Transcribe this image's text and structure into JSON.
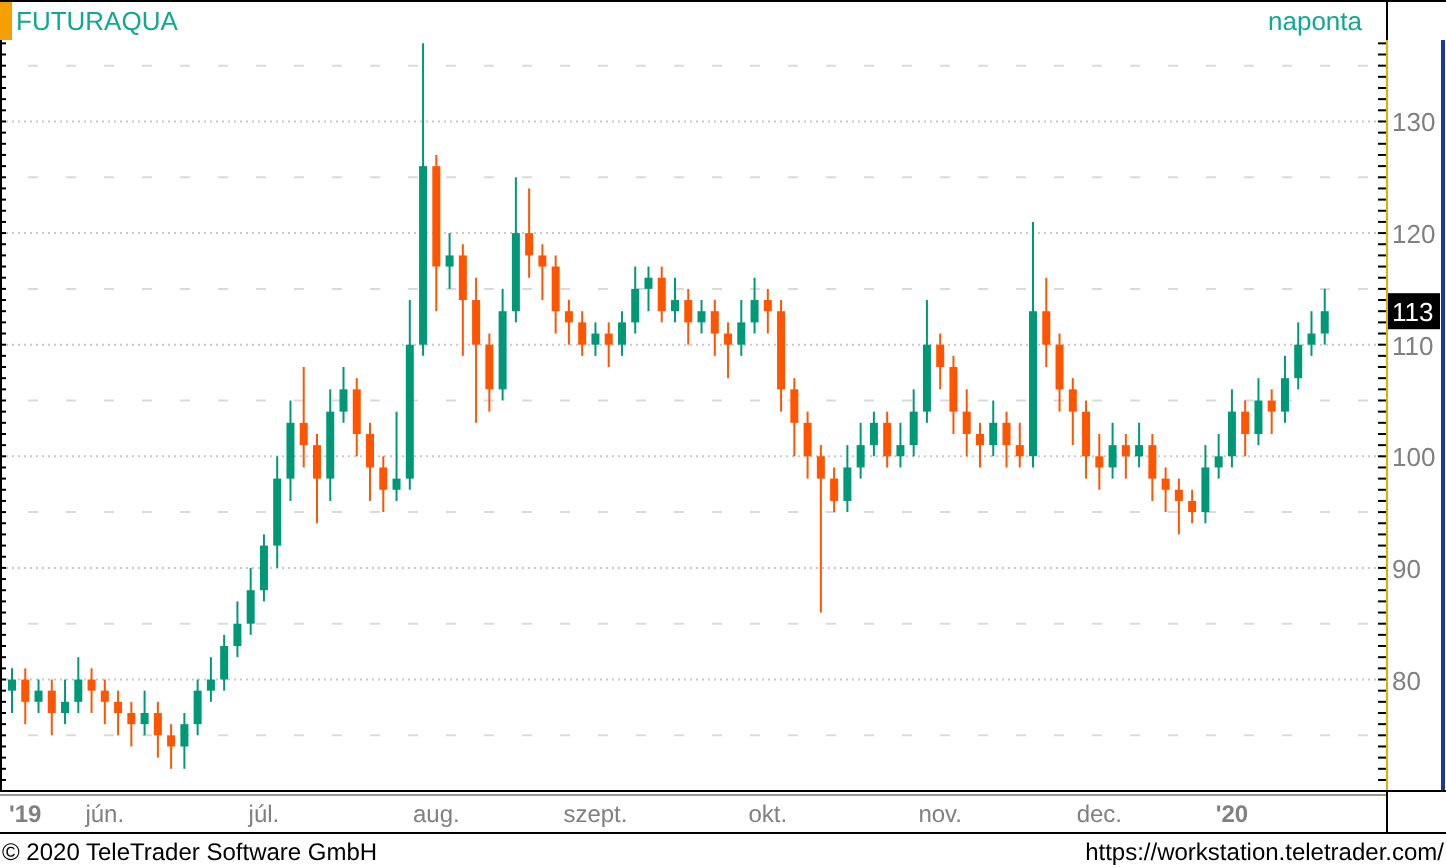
{
  "header": {
    "symbol": "FUTURAQUA",
    "interval": "naponta"
  },
  "chart": {
    "last_price_label": "113",
    "chart_data": {
      "type": "candlestick",
      "grid": true,
      "ylim": [
        70.1,
        137.3
      ],
      "yticks": [
        80,
        90,
        100,
        110,
        120,
        130
      ],
      "categories": [
        null,
        "'19",
        null,
        null,
        null,
        null,
        null,
        "jún.",
        null,
        null,
        null,
        null,
        null,
        null,
        null,
        null,
        null,
        null,
        null,
        "júl.",
        null,
        null,
        null,
        null,
        null,
        null,
        null,
        null,
        null,
        null,
        null,
        null,
        "aug.",
        null,
        null,
        null,
        null,
        null,
        null,
        null,
        null,
        null,
        null,
        null,
        "szept.",
        null,
        null,
        null,
        null,
        null,
        null,
        null,
        null,
        null,
        null,
        null,
        null,
        "okt.",
        null,
        null,
        null,
        null,
        null,
        null,
        null,
        null,
        null,
        null,
        null,
        null,
        "nov.",
        null,
        null,
        null,
        null,
        null,
        null,
        null,
        null,
        null,
        null,
        null,
        "dec.",
        null,
        null,
        null,
        null,
        null,
        null,
        null,
        null,
        null,
        "'20",
        null,
        null,
        null,
        null,
        null,
        null,
        null
      ],
      "ohlc": [
        [
          79,
          81,
          77,
          80
        ],
        [
          80,
          81,
          76,
          78
        ],
        [
          78,
          80,
          77,
          79
        ],
        [
          79,
          80,
          75,
          77
        ],
        [
          77,
          80,
          76,
          78
        ],
        [
          78,
          82,
          77,
          80
        ],
        [
          80,
          81,
          77,
          79
        ],
        [
          79,
          80,
          76,
          78
        ],
        [
          78,
          79,
          75,
          77
        ],
        [
          77,
          78,
          74,
          76
        ],
        [
          76,
          79,
          75,
          77
        ],
        [
          77,
          78,
          73,
          75
        ],
        [
          75,
          76,
          72,
          74
        ],
        [
          74,
          77,
          72,
          76
        ],
        [
          76,
          80,
          75,
          79
        ],
        [
          79,
          82,
          78,
          80
        ],
        [
          80,
          84,
          79,
          83
        ],
        [
          83,
          87,
          82,
          85
        ],
        [
          85,
          90,
          84,
          88
        ],
        [
          88,
          93,
          87,
          92
        ],
        [
          92,
          100,
          90,
          98
        ],
        [
          98,
          105,
          96,
          103
        ],
        [
          103,
          108,
          99,
          101
        ],
        [
          101,
          102,
          94,
          98
        ],
        [
          98,
          106,
          96,
          104
        ],
        [
          104,
          108,
          103,
          106
        ],
        [
          106,
          107,
          100,
          102
        ],
        [
          102,
          103,
          96,
          99
        ],
        [
          99,
          100,
          95,
          97
        ],
        [
          97,
          104,
          96,
          98
        ],
        [
          98,
          114,
          97,
          110
        ],
        [
          110,
          137,
          109,
          126
        ],
        [
          126,
          127,
          113,
          117
        ],
        [
          117,
          120,
          115,
          118
        ],
        [
          118,
          119,
          109,
          114
        ],
        [
          114,
          116,
          103,
          110
        ],
        [
          110,
          111,
          104,
          106
        ],
        [
          106,
          115,
          105,
          113
        ],
        [
          113,
          125,
          112,
          120
        ],
        [
          120,
          124,
          116,
          118
        ],
        [
          118,
          119,
          114,
          117
        ],
        [
          117,
          118,
          111,
          113
        ],
        [
          113,
          114,
          110,
          112
        ],
        [
          112,
          113,
          109,
          110
        ],
        [
          110,
          112,
          109,
          111
        ],
        [
          111,
          112,
          108,
          110
        ],
        [
          110,
          113,
          109,
          112
        ],
        [
          112,
          117,
          111,
          115
        ],
        [
          115,
          117,
          113,
          116
        ],
        [
          116,
          117,
          112,
          113
        ],
        [
          113,
          116,
          112,
          114
        ],
        [
          114,
          115,
          110,
          112
        ],
        [
          112,
          114,
          111,
          113
        ],
        [
          113,
          114,
          109,
          111
        ],
        [
          111,
          112,
          107,
          110
        ],
        [
          110,
          114,
          109,
          112
        ],
        [
          112,
          116,
          111,
          114
        ],
        [
          114,
          115,
          111,
          113
        ],
        [
          113,
          114,
          104,
          106
        ],
        [
          106,
          107,
          100,
          103
        ],
        [
          103,
          104,
          98,
          100
        ],
        [
          100,
          101,
          86,
          98
        ],
        [
          98,
          99,
          95,
          96
        ],
        [
          96,
          101,
          95,
          99
        ],
        [
          99,
          103,
          98,
          101
        ],
        [
          101,
          104,
          100,
          103
        ],
        [
          103,
          104,
          99,
          100
        ],
        [
          100,
          103,
          99,
          101
        ],
        [
          101,
          106,
          100,
          104
        ],
        [
          104,
          114,
          103,
          110
        ],
        [
          110,
          111,
          106,
          108
        ],
        [
          108,
          109,
          102,
          104
        ],
        [
          104,
          106,
          100,
          102
        ],
        [
          102,
          103,
          99,
          101
        ],
        [
          101,
          105,
          100,
          103
        ],
        [
          103,
          104,
          99,
          101
        ],
        [
          101,
          103,
          99,
          100
        ],
        [
          100,
          121,
          99,
          113
        ],
        [
          113,
          116,
          108,
          110
        ],
        [
          110,
          111,
          104,
          106
        ],
        [
          106,
          107,
          101,
          104
        ],
        [
          104,
          105,
          98,
          100
        ],
        [
          100,
          102,
          97,
          99
        ],
        [
          99,
          103,
          98,
          101
        ],
        [
          101,
          102,
          98,
          100
        ],
        [
          100,
          103,
          99,
          101
        ],
        [
          101,
          102,
          96,
          98
        ],
        [
          98,
          99,
          95,
          97
        ],
        [
          97,
          98,
          93,
          96
        ],
        [
          96,
          97,
          94,
          95
        ],
        [
          95,
          101,
          94,
          99
        ],
        [
          99,
          102,
          98,
          100
        ],
        [
          100,
          106,
          99,
          104
        ],
        [
          104,
          105,
          100,
          102
        ],
        [
          102,
          107,
          101,
          105
        ],
        [
          105,
          106,
          102,
          104
        ],
        [
          104,
          109,
          103,
          107
        ],
        [
          107,
          112,
          106,
          110
        ],
        [
          110,
          113,
          109,
          111
        ],
        [
          111,
          115,
          110,
          113
        ]
      ]
    }
  },
  "footer": {
    "copyright": "© 2020 TeleTrader Software GmbH",
    "url": "https://workstation.teletrader.com/"
  }
}
